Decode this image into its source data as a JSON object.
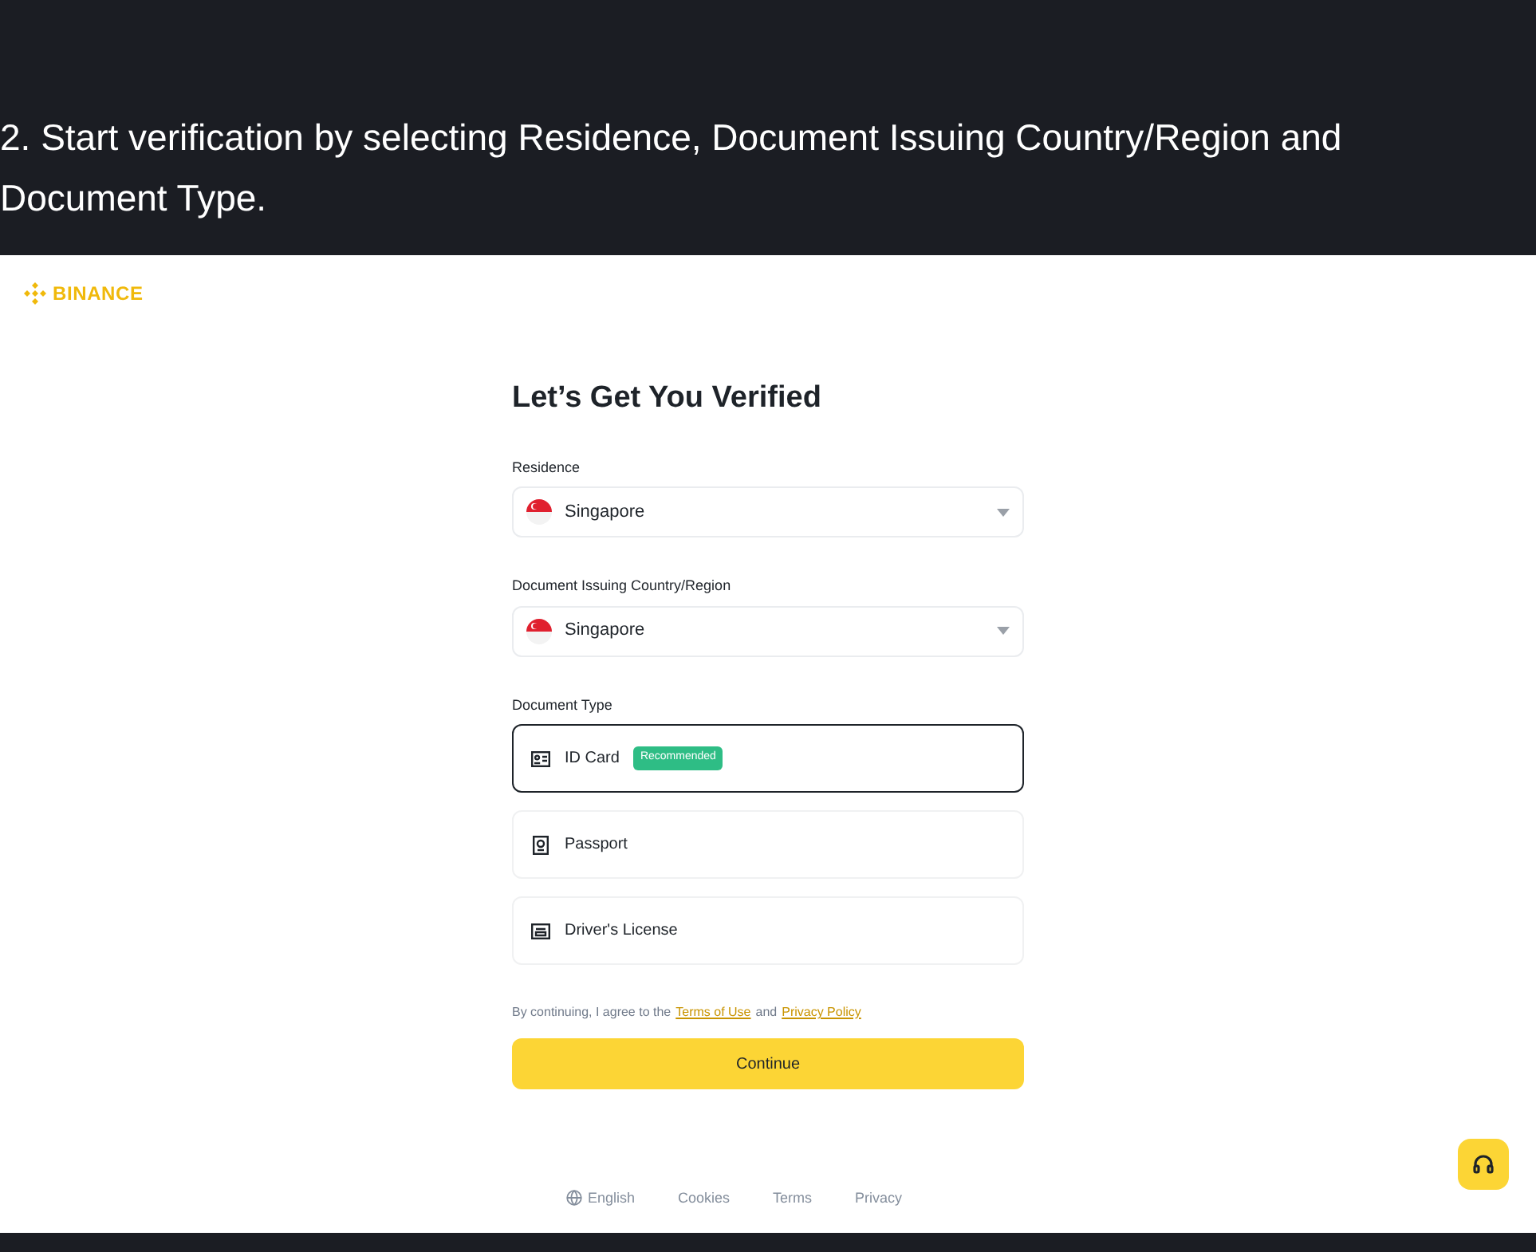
{
  "caption": "2. Start verification by selecting Residence, Document Issuing Country/Region and Document Type.",
  "logo": {
    "text": "BINANCE"
  },
  "form": {
    "title": "Let’s Get You Verified",
    "residence": {
      "label": "Residence",
      "value": "Singapore"
    },
    "issuing_country": {
      "label": "Document Issuing Country/Region",
      "value": "Singapore"
    },
    "document_type": {
      "label": "Document Type",
      "options": [
        {
          "kind": "id",
          "label": "ID Card",
          "badge": "Recommended",
          "selected": true
        },
        {
          "kind": "passport",
          "label": "Passport",
          "selected": false
        },
        {
          "kind": "license",
          "label": "Driver's License",
          "selected": false
        }
      ]
    },
    "agreement": {
      "before": "By continuing, I agree to the",
      "terms_link": "Terms of Use",
      "middle": "and",
      "privacy_link": "Privacy Policy"
    },
    "continue_button": "Continue"
  },
  "footer": {
    "language": "English",
    "links": [
      "Cookies",
      "Terms",
      "Privacy"
    ]
  }
}
